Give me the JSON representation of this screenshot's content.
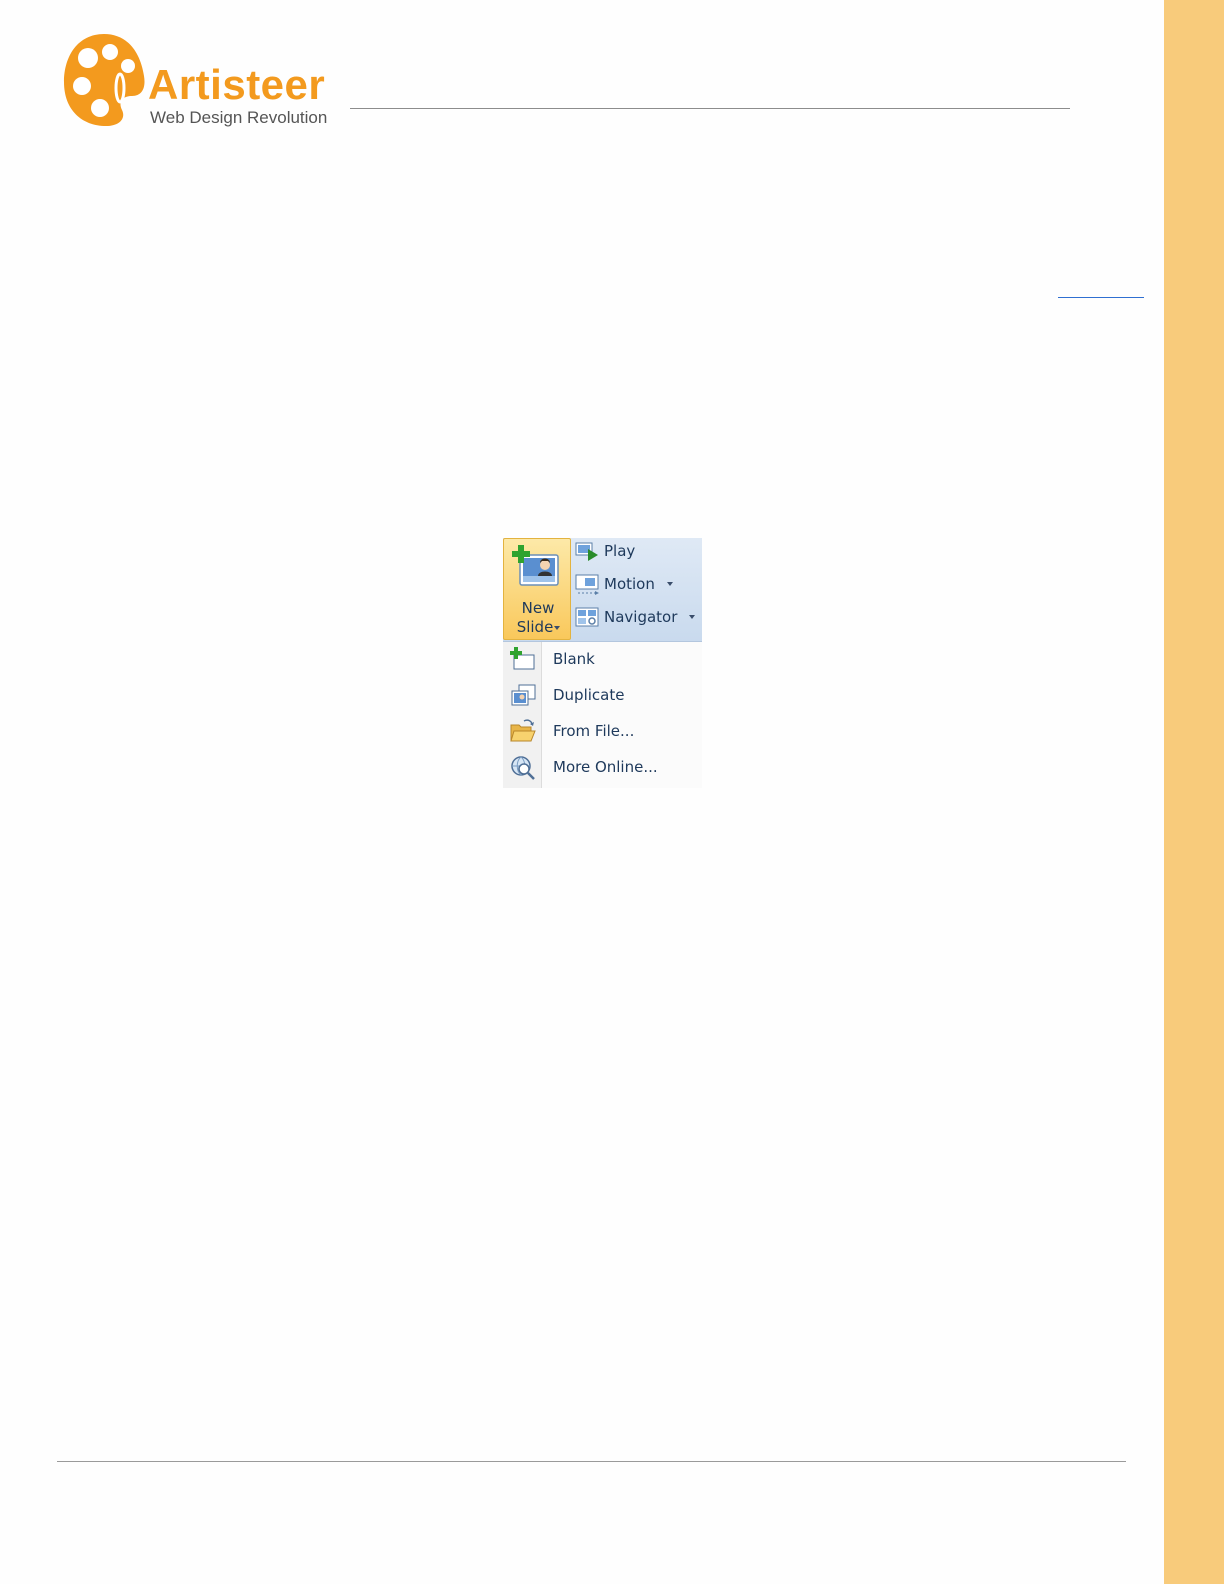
{
  "header": {
    "brand_name": "Artisteer",
    "brand_tagline": "Web Design Revolution"
  },
  "colors": {
    "brand_orange": "#f39a1e",
    "side_band": "#f8cb7b",
    "ribbon_text": "#1e395b",
    "link_blue": "#2f6fd1"
  },
  "ribbon": {
    "new_slide": {
      "line1": "New",
      "line2": "Slide",
      "icon": "new-slide-icon"
    },
    "items": [
      {
        "label": "Play",
        "icon": "play-icon"
      },
      {
        "label": "Motion",
        "icon": "motion-icon"
      },
      {
        "label": "Navigator",
        "icon": "navigator-icon"
      }
    ]
  },
  "new_slide_menu": {
    "items": [
      {
        "label": "Blank",
        "icon": "blank-slide-icon"
      },
      {
        "label": "Duplicate",
        "icon": "duplicate-icon"
      },
      {
        "label": "From File...",
        "icon": "folder-open-icon"
      },
      {
        "label": "More Online...",
        "icon": "globe-search-icon"
      }
    ]
  }
}
